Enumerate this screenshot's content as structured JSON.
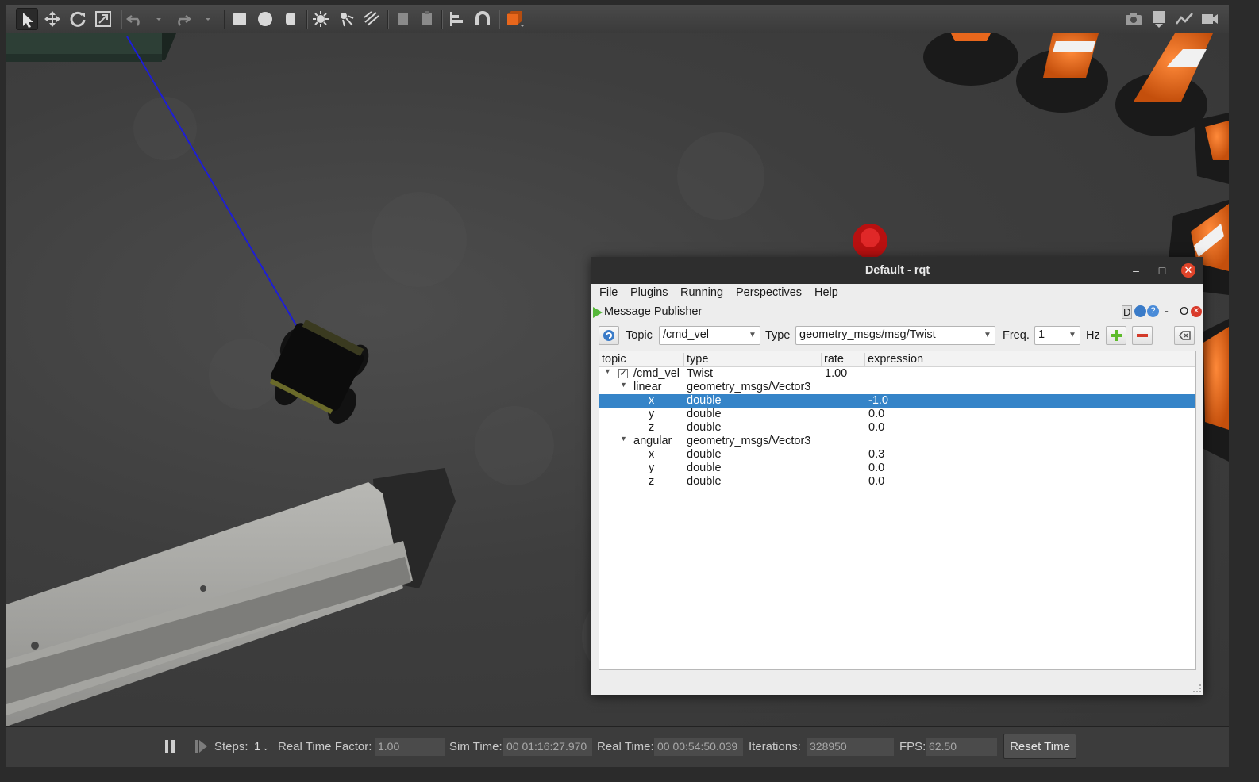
{
  "gazebo": {
    "toolbar": {
      "tools": [
        "select-mode",
        "translate-mode",
        "rotate-mode",
        "scale-mode",
        "undo",
        "undo-history",
        "redo",
        "redo-history",
        "box",
        "sphere",
        "cylinder",
        "point-light",
        "spot-light",
        "directional-light",
        "copy",
        "paste",
        "align",
        "snap",
        "change-view",
        "screenshot",
        "log",
        "plot",
        "record-video"
      ]
    },
    "bottom_bar": {
      "steps_label": "Steps:",
      "steps_value": "1",
      "rtf_label": "Real Time Factor:",
      "rtf_value": "1.00",
      "sim_time_label": "Sim Time:",
      "sim_time_value": "00 01:16:27.970",
      "real_time_label": "Real Time:",
      "real_time_value": "00 00:54:50.039",
      "iterations_label": "Iterations:",
      "iterations_value": "328950",
      "fps_label": "FPS:",
      "fps_value": "62.50",
      "reset_label": "Reset Time"
    }
  },
  "rqt": {
    "title": "Default - rqt",
    "menu": {
      "file": "File",
      "plugins": "Plugins",
      "running": "Running",
      "perspectives": "Perspectives",
      "help": "Help"
    },
    "plugin": {
      "title": "Message Publisher",
      "d_label": "D",
      "minus_label": "-",
      "o_label": "O"
    },
    "controls": {
      "topic_label": "Topic",
      "topic_value": "/cmd_vel",
      "type_label": "Type",
      "type_value": "geometry_msgs/msg/Twist",
      "freq_label": "Freq.",
      "freq_value": "1",
      "hz_label": "Hz"
    },
    "tree": {
      "headers": {
        "topic": "topic",
        "type": "type",
        "rate": "rate",
        "expression": "expression"
      },
      "rows": [
        {
          "topic": "/cmd_vel",
          "type": "Twist",
          "rate": "1.00",
          "expression": ""
        },
        {
          "topic": "linear",
          "type": "geometry_msgs/Vector3",
          "rate": "",
          "expression": ""
        },
        {
          "topic": "x",
          "type": "double",
          "rate": "",
          "expression": "-1.0"
        },
        {
          "topic": "y",
          "type": "double",
          "rate": "",
          "expression": "0.0"
        },
        {
          "topic": "z",
          "type": "double",
          "rate": "",
          "expression": "0.0"
        },
        {
          "topic": "angular",
          "type": "geometry_msgs/Vector3",
          "rate": "",
          "expression": ""
        },
        {
          "topic": "x",
          "type": "double",
          "rate": "",
          "expression": "0.3"
        },
        {
          "topic": "y",
          "type": "double",
          "rate": "",
          "expression": "0.0"
        },
        {
          "topic": "z",
          "type": "double",
          "rate": "",
          "expression": "0.0"
        }
      ]
    }
  },
  "colors": {
    "selection": "#3584c8",
    "close_button": "#e0442a",
    "cone_orange": "#e8671c"
  }
}
